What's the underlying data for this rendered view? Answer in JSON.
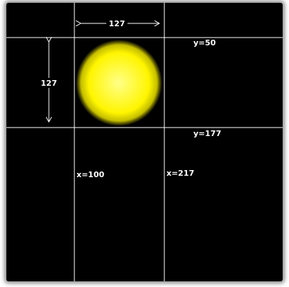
{
  "diagram": {
    "width_dimension_label": "127",
    "height_dimension_label": "127",
    "y_label_top": "y=50",
    "y_label_bottom": "y=177",
    "x_label_left": "x=100",
    "x_label_right": "x=217"
  },
  "colors": {
    "background": "#000000",
    "grid_line": "#ffffff",
    "sun_center": "#ffff66",
    "sun_edge": "#f2ea00",
    "arrow": "#ffffff"
  }
}
